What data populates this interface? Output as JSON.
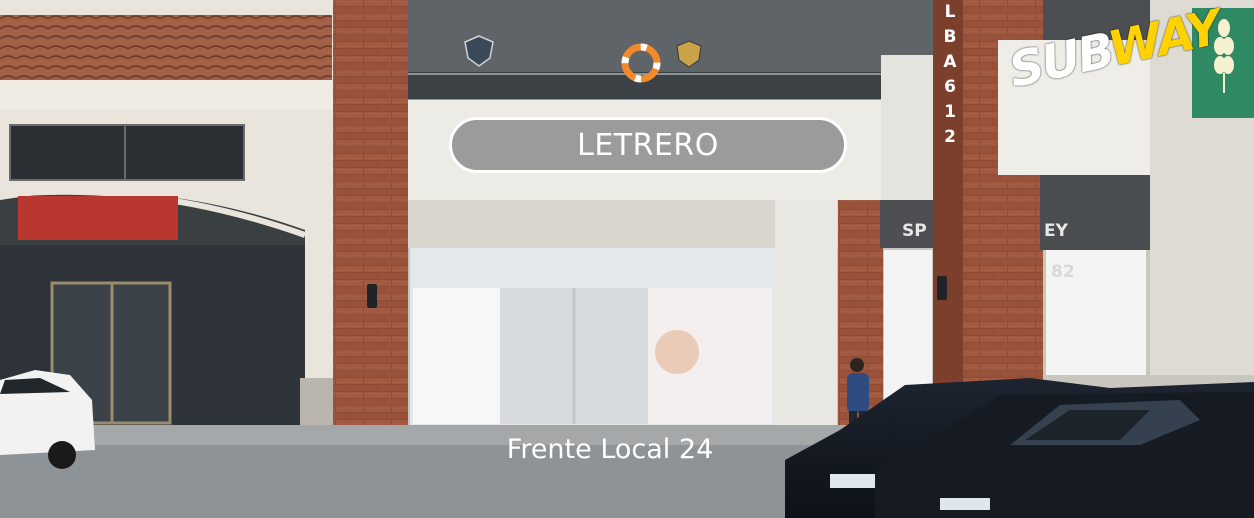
{
  "sign": {
    "text": "LETRERO"
  },
  "caption": {
    "text": "Frente Local 24"
  },
  "subway": {
    "part1": "SUB",
    "part2": "WAY"
  },
  "pillar_letters": [
    "L",
    "B",
    "A",
    "6",
    "1",
    "2"
  ],
  "storefront_left_text": "SP",
  "storefront_right_text": "EY",
  "storefront_number": "82",
  "colors": {
    "sign_bg": "#9b9b9b",
    "sign_border": "#ffffff",
    "brick": "#8a4a35",
    "subway_yellow": "#ffd200",
    "subway_green": "#2e8b57"
  },
  "icons": [
    "lifebuoy-icon",
    "badge-icon",
    "shield-icon",
    "wheat-icon",
    "wall-lamp-icon"
  ]
}
